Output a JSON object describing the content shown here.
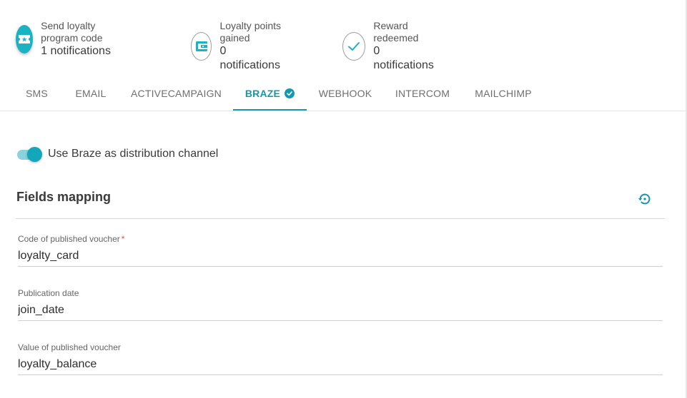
{
  "steps": [
    {
      "title": "Send loyalty program code",
      "sub": "1 notifications",
      "icon": "ticket-icon",
      "active": true
    },
    {
      "title": "Loyalty points gained",
      "sub": "0 notifications",
      "icon": "wallet-icon",
      "active": false
    },
    {
      "title": "Reward redeemed",
      "sub": "0 notifications",
      "icon": "check-icon",
      "active": false
    }
  ],
  "tabs": [
    {
      "label": "SMS"
    },
    {
      "label": "EMAIL"
    },
    {
      "label": "ACTIVECAMPAIGN"
    },
    {
      "label": "BRAZE",
      "active": true,
      "badge": "check-circle-icon"
    },
    {
      "label": "WEBHOOK"
    },
    {
      "label": "INTERCOM"
    },
    {
      "label": "MAILCHIMP"
    }
  ],
  "toggle": {
    "label": "Use Braze as distribution channel",
    "on": true
  },
  "section": {
    "title": "Fields mapping",
    "action_icon": "restore-icon"
  },
  "fields": [
    {
      "label": "Code of published voucher",
      "required_mark": "*",
      "value": "loyalty_card"
    },
    {
      "label": "Publication date",
      "value": "join_date"
    },
    {
      "label": "Value of published voucher",
      "value": "loyalty_balance"
    }
  ],
  "colors": {
    "accent": "#1597ad",
    "accent_light": "#1bb2c4",
    "toggle_track": "#8ad3dc",
    "required": "#d9534f"
  }
}
